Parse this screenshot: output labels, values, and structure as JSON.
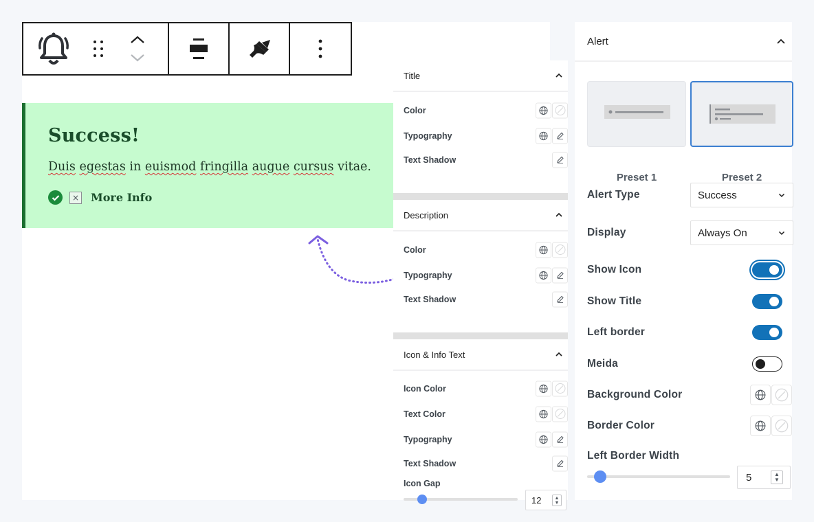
{
  "alert": {
    "title": "Success!",
    "description_words": [
      "Duis",
      "egestas",
      "in",
      "euismod",
      "fringilla",
      "augue",
      "cursus",
      "vitae."
    ],
    "more_info": "More Info",
    "dismiss_glyph": "×"
  },
  "middle_panel": {
    "title_section": {
      "heading": "Title",
      "rows": [
        "Color",
        "Typography",
        "Text Shadow"
      ]
    },
    "description_section": {
      "heading": "Description",
      "rows": [
        "Color",
        "Typography",
        "Text Shadow"
      ]
    },
    "icon_section": {
      "heading": "Icon & Info Text",
      "rows": [
        "Icon Color",
        "Text Color",
        "Typography",
        "Text Shadow"
      ],
      "gap_label": "Icon Gap",
      "gap_value": "12"
    }
  },
  "right_panel": {
    "heading": "Alert",
    "presets": [
      "Preset 1",
      "Preset 2"
    ],
    "selected_preset": "Preset 2",
    "alert_type": {
      "label": "Alert Type",
      "value": "Success"
    },
    "display": {
      "label": "Display",
      "value": "Always On"
    },
    "toggles": [
      {
        "label": "Show Icon",
        "on": true
      },
      {
        "label": "Show Title",
        "on": true
      },
      {
        "label": "Left border",
        "on": true
      },
      {
        "label": "Meida",
        "on": false
      }
    ],
    "background_color_label": "Background Color",
    "border_color_label": "Border Color",
    "left_border_width": {
      "label": "Left Border Width",
      "value": "5"
    }
  },
  "colors": {
    "alert_bg": "#c6fbcf",
    "alert_border": "#1b6e30",
    "toggle_on": "#1272b8",
    "slider_accent": "#5d8ef2",
    "arrow": "#7b5fe0"
  }
}
